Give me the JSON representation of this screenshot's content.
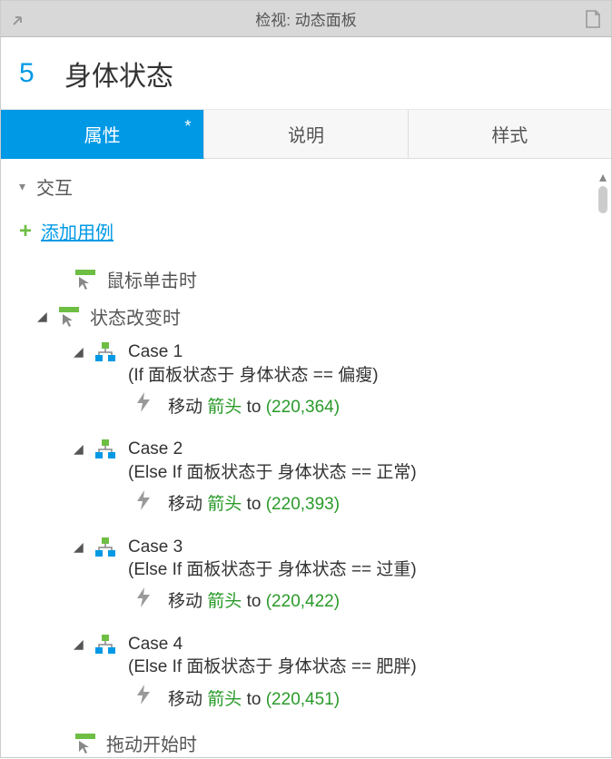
{
  "header": {
    "title": "检视: 动态面板"
  },
  "widget": {
    "index": "5",
    "name": "身体状态"
  },
  "tabs": [
    {
      "label": "属性",
      "active": true,
      "dirty": "*"
    },
    {
      "label": "说明",
      "active": false
    },
    {
      "label": "样式",
      "active": false
    }
  ],
  "section": {
    "title": "交互",
    "addCase": "添加用例"
  },
  "events": [
    {
      "label": "鼠标单击时",
      "expandable": false,
      "cases": []
    },
    {
      "label": "状态改变时",
      "expandable": true,
      "cases": [
        {
          "label": "Case 1",
          "condition": "(If 面板状态于 身体状态 == 偏瘦)",
          "action": {
            "verb": "移动",
            "target": "箭头",
            "to": "to",
            "coords": "(220,364)"
          }
        },
        {
          "label": "Case 2",
          "condition": "(Else If 面板状态于 身体状态 == 正常)",
          "action": {
            "verb": "移动",
            "target": "箭头",
            "to": "to",
            "coords": "(220,393)"
          }
        },
        {
          "label": "Case 3",
          "condition": "(Else If 面板状态于 身体状态 == 过重)",
          "action": {
            "verb": "移动",
            "target": "箭头",
            "to": "to",
            "coords": "(220,422)"
          }
        },
        {
          "label": "Case 4",
          "condition": "(Else If 面板状态于 身体状态 == 肥胖)",
          "action": {
            "verb": "移动",
            "target": "箭头",
            "to": "to",
            "coords": "(220,451)"
          }
        }
      ]
    },
    {
      "label": "拖动开始时",
      "expandable": false,
      "cases": []
    }
  ]
}
